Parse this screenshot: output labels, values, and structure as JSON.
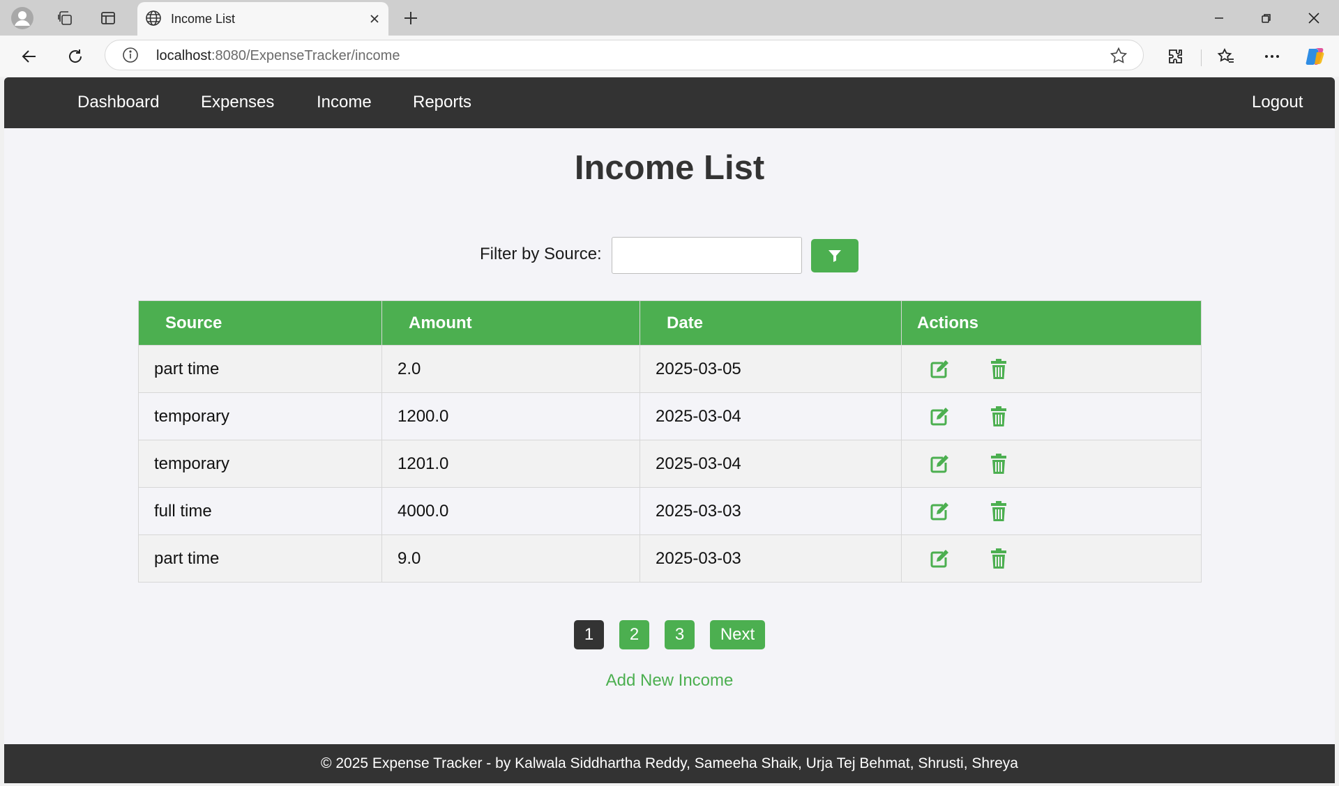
{
  "browser": {
    "tab_title": "Income List",
    "url_host": "localhost",
    "url_path": ":8080/ExpenseTracker/income"
  },
  "site_nav": {
    "items": [
      "Dashboard",
      "Expenses",
      "Income",
      "Reports"
    ],
    "logout": "Logout"
  },
  "page": {
    "title": "Income List",
    "filter_label": "Filter by Source:",
    "filter_value": "",
    "filter_icon": "filter-icon"
  },
  "table": {
    "headers": [
      "Source",
      "Amount",
      "Date",
      "Actions"
    ],
    "rows": [
      {
        "source": "part time",
        "amount": "2.0",
        "date": "2025-03-05"
      },
      {
        "source": "temporary",
        "amount": "1200.0",
        "date": "2025-03-04"
      },
      {
        "source": "temporary",
        "amount": "1201.0",
        "date": "2025-03-04"
      },
      {
        "source": "full time",
        "amount": "4000.0",
        "date": "2025-03-03"
      },
      {
        "source": "part time",
        "amount": "9.0",
        "date": "2025-03-03"
      }
    ],
    "action_icons": [
      "edit-icon",
      "trash-icon"
    ]
  },
  "pagination": {
    "pages": [
      "1",
      "2",
      "3"
    ],
    "current": "1",
    "next": "Next"
  },
  "add_link": "Add New Income",
  "footer": "© 2025 Expense Tracker - by Kalwala Siddhartha Reddy, Sameeha Shaik, Urja Tej Behmat, Shrusti, Shreya",
  "colors": {
    "accent": "#4caf50",
    "dark": "#333333"
  }
}
